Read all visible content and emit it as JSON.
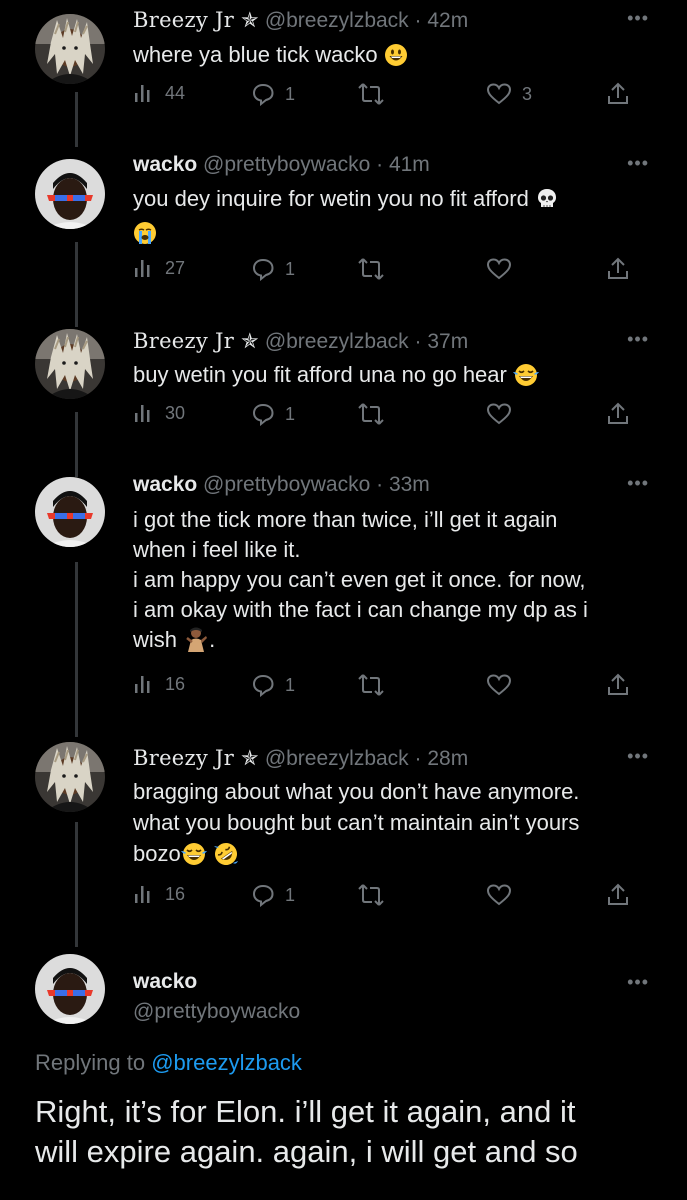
{
  "colors": {
    "background": "#000000",
    "text": "#e7e9ea",
    "muted": "#71767b",
    "link": "#1d9bf0",
    "thread_line": "#333639"
  },
  "tweets": [
    {
      "name": "Breezy Jr ✯",
      "handle": "@breezylzback",
      "time": "· 42m",
      "text": "where ya blue tick wacko",
      "emoji": [
        "grinning-face"
      ],
      "views": "44",
      "replies": "1",
      "retweets": "",
      "likes": "3"
    },
    {
      "name": "wacko",
      "handle": "@prettyboywacko",
      "time": "· 41m",
      "text": "you dey inquire for wetin you no fit afford",
      "emoji": [
        "skull",
        "loudly-crying-face"
      ],
      "views": "27",
      "replies": "1",
      "retweets": "",
      "likes": ""
    },
    {
      "name": "Breezy Jr ✯",
      "handle": "@breezylzback",
      "time": "· 37m",
      "text": "buy wetin you fit afford una no go hear",
      "emoji": [
        "face-with-tears-of-joy"
      ],
      "views": "30",
      "replies": "1",
      "retweets": "",
      "likes": ""
    },
    {
      "name": "wacko",
      "handle": "@prettyboywacko",
      "time": "· 33m",
      "text_line1": "i got the tick more than twice, i’ll get it again",
      "text_line2": "when i feel like it.",
      "text_line3": "i am happy you can’t even get it once. for now,",
      "text_line4": "i am okay with the fact i can change my dp as i",
      "text_line5": "wish",
      "text_line5_end": ".",
      "emoji": [
        "person-tipping-hand"
      ],
      "views": "16",
      "replies": "1",
      "retweets": "",
      "likes": ""
    },
    {
      "name": "Breezy Jr ✯",
      "handle": "@breezylzback",
      "time": "· 28m",
      "text_line1": "bragging about what you don’t have anymore.",
      "text_line2": "what you bought but can’t maintain ain’t yours",
      "text_line3": "bozo",
      "emoji": [
        "face-with-tears-of-joy",
        "rolling-on-floor-laughing"
      ],
      "views": "16",
      "replies": "1",
      "retweets": "",
      "likes": ""
    }
  ],
  "main_tweet": {
    "name": "wacko",
    "handle": "@prettyboywacko",
    "replying_prefix": "Replying to",
    "replying_handle": "@breezylzback",
    "text_line1": "Right, it’s for Elon. i’ll get it again, and it",
    "text_line2": "will expire again. again, i will get and so"
  },
  "icons": [
    "views-icon",
    "reply-icon",
    "retweet-icon",
    "like-icon",
    "share-icon",
    "more-icon"
  ]
}
